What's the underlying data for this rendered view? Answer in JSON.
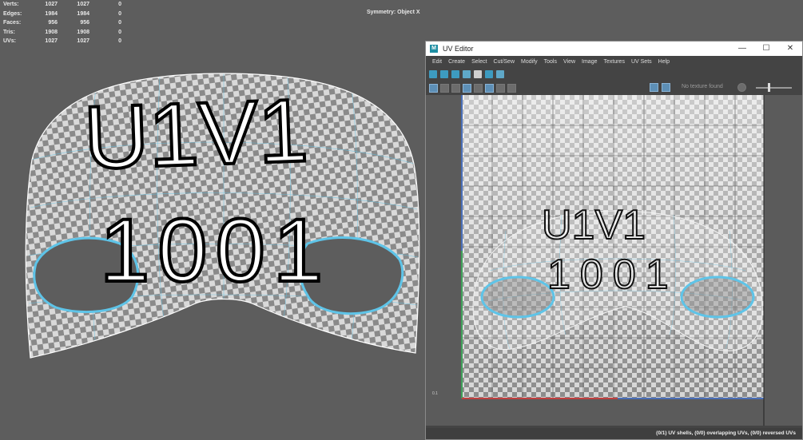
{
  "hud": {
    "rows": [
      {
        "label": "Verts:",
        "a": "1027",
        "b": "1027",
        "c": "0"
      },
      {
        "label": "Edges:",
        "a": "1984",
        "b": "1984",
        "c": "0"
      },
      {
        "label": "Faces:",
        "a": "956",
        "b": "956",
        "c": "0"
      },
      {
        "label": "Tris:",
        "a": "1908",
        "b": "1908",
        "c": "0"
      },
      {
        "label": "UVs:",
        "a": "1027",
        "b": "1027",
        "c": "0"
      }
    ],
    "symmetry": "Symmetry: Object X"
  },
  "viewport": {
    "text_top": "U1V1",
    "text_bottom": "1001"
  },
  "uv_editor": {
    "app_icon": "M",
    "title": "UV Editor",
    "controls": {
      "minimize": "—",
      "maximize": "☐",
      "close": "✕"
    },
    "menu": [
      "Edit",
      "Create",
      "Select",
      "Cut/Sew",
      "Modify",
      "Tools",
      "View",
      "Image",
      "Textures",
      "UV Sets",
      "Help"
    ],
    "no_texture": "No texture found",
    "coord": "0.1",
    "text_top": "U1V1",
    "text_bottom": "1001",
    "status": "(0/1) UV shells, (0/0) overlapping UVs, (0/0) reversed UVs"
  },
  "colors": {
    "background": "#5d5d5d",
    "checker_dark": "#8a8a8a",
    "checker_light": "#d9d9d9",
    "wire": "#5ec4e8"
  }
}
